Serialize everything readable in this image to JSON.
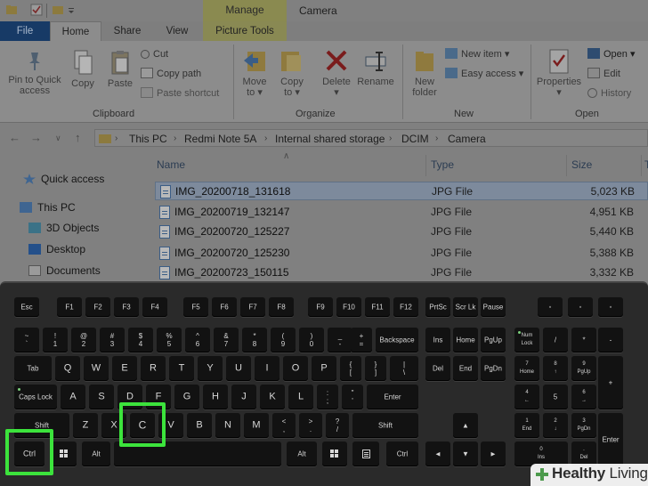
{
  "window": {
    "title": "Camera",
    "context_tab_group": "Manage",
    "context_tab": "Picture Tools"
  },
  "ribbon_tabs": [
    "File",
    "Home",
    "Share",
    "View"
  ],
  "ribbon": {
    "clipboard": {
      "group_label": "Clipboard",
      "pin": "Pin to Quick\naccess",
      "copy": "Copy",
      "paste": "Paste",
      "cut": "Cut",
      "copy_path": "Copy path",
      "paste_shortcut": "Paste shortcut"
    },
    "organize": {
      "group_label": "Organize",
      "move_to": "Move\nto ▾",
      "copy_to": "Copy\nto ▾",
      "delete": "Delete\n▾",
      "rename": "Rename"
    },
    "new": {
      "group_label": "New",
      "new_folder": "New\nfolder",
      "new_item": "New item ▾",
      "easy_access": "Easy access ▾"
    },
    "open": {
      "group_label": "Open",
      "properties": "Properties\n▾",
      "open": "Open ▾",
      "edit": "Edit",
      "history": "History"
    }
  },
  "address": {
    "crumbs": [
      "This PC",
      "Redmi Note 5A",
      "Internal shared storage",
      "DCIM",
      "Camera"
    ]
  },
  "nav_pane": {
    "items": [
      "Quick access",
      "This PC",
      "3D Objects",
      "Desktop",
      "Documents"
    ]
  },
  "file_list": {
    "columns": {
      "name": "Name",
      "type": "Type",
      "size": "Size",
      "extra": "T"
    },
    "rows": [
      {
        "name": "IMG_20200718_131618",
        "type": "JPG File",
        "size": "5,023 KB",
        "selected": true
      },
      {
        "name": "IMG_20200719_132147",
        "type": "JPG File",
        "size": "4,951 KB",
        "selected": false
      },
      {
        "name": "IMG_20200720_125227",
        "type": "JPG File",
        "size": "5,440 KB",
        "selected": false
      },
      {
        "name": "IMG_20200720_125230",
        "type": "JPG File",
        "size": "5,388 KB",
        "selected": false
      },
      {
        "name": "IMG_20200723_150115",
        "type": "JPG File",
        "size": "3,332 KB",
        "selected": false
      }
    ]
  },
  "keyboard": {
    "highlight_color": "#3ce33c",
    "highlighted_keys": [
      "Ctrl",
      "C"
    ],
    "keys": {
      "esc": "Esc",
      "f1": "F1",
      "f2": "F2",
      "f3": "F3",
      "f4": "F4",
      "f5": "F5",
      "f6": "F6",
      "f7": "F7",
      "f8": "F8",
      "f9": "F9",
      "f10": "F10",
      "f11": "F11",
      "f12": "F12",
      "prtsc": "PrtSc",
      "scrlk": "Scr Lk",
      "pause": "Pause",
      "tilde": "~\n`",
      "n1": "!\n1",
      "n2": "@\n2",
      "n3": "#\n3",
      "n4": "$\n4",
      "n5": "%\n5",
      "n6": "^\n6",
      "n7": "&\n7",
      "n8": "*\n8",
      "n9": "(\n9",
      "n0": ")\n0",
      "minus": "_\n-",
      "plus": "+\n=",
      "backspace": "Backspace",
      "ins": "Ins",
      "home": "Home",
      "pgup": "PgUp",
      "numlock": "Num\nLock",
      "np_div": "/",
      "np_mul": "*",
      "np_minus": "-",
      "tab": "Tab",
      "q": "Q",
      "w": "W",
      "e": "E",
      "r": "R",
      "t": "T",
      "y": "Y",
      "u": "U",
      "i": "I",
      "o": "O",
      "p": "P",
      "lbracket": "{\n[",
      "rbracket": "}\n]",
      "bslash": "|\n\\",
      "del": "Del",
      "end": "End",
      "pgdn": "PgDn",
      "np7": "7\nHome",
      "np8": "8\n↑",
      "np9": "9\nPgUp",
      "np_plus": "+",
      "capslock": "Caps Lock",
      "a": "A",
      "s": "S",
      "d": "D",
      "f": "F",
      "g": "G",
      "h": "H",
      "j": "J",
      "k": "K",
      "l": "L",
      "semicolon": ":\n;",
      "quote": "\"\n'",
      "enter": "Enter",
      "np4": "4\n←",
      "np5": "5",
      "np6": "6\n→",
      "lshift": "Shift",
      "z": "Z",
      "x": "X",
      "c": "C",
      "v": "V",
      "b": "B",
      "n": "N",
      "m": "M",
      "comma": "<\n,",
      "period": ">\n.",
      "slash": "?\n/",
      "rshift": "Shift",
      "up": "▲",
      "np1": "1\nEnd",
      "np2": "2\n↓",
      "np3": "3\nPgDn",
      "np_enter": "Enter",
      "lctrl": "Ctrl",
      "lalt": "Alt",
      "ralt": "Alt",
      "rctrl": "Ctrl",
      "left": "◄",
      "down": "▼",
      "right": "►",
      "np0": "0\nIns",
      "np_dot": ".\nDel"
    }
  },
  "watermark": {
    "brand_bold": "Healthy",
    "brand_light": "Living"
  }
}
